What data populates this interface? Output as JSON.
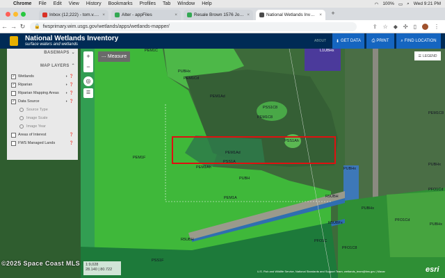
{
  "menubar": {
    "items": [
      "Chrome",
      "File",
      "Edit",
      "View",
      "History",
      "Bookmarks",
      "Profiles",
      "Tab",
      "Window",
      "Help"
    ],
    "battery": "100%",
    "clock": "Wed 9:21 PM"
  },
  "tabs": [
    {
      "title": "Inbox (12,222) - tom.v.donnel...",
      "color": "#d93025"
    },
    {
      "title": "Alter - appFiles",
      "color": "#34a853"
    },
    {
      "title": "Resale Brown 1576 Jones Rd ...",
      "color": "#34a853"
    },
    {
      "title": "National Wetlands Inventory",
      "color": "#4a4a4a",
      "active": true
    }
  ],
  "address": {
    "url": "fwsprimary.wim.usgs.gov/wetlands/apps/wetlands-mapper/"
  },
  "app": {
    "title": "National Wetlands Inventory",
    "subtitle": "surface waters and wetlands",
    "about": "ABOUT",
    "buttons": {
      "get_data": "GET DATA",
      "print": "PRINT",
      "find_location": "FIND LOCATION"
    }
  },
  "panel": {
    "basemaps": "BASEMAPS",
    "map_layers": "MAP LAYERS",
    "layers": [
      {
        "label": "Wetlands",
        "checked": true
      },
      {
        "label": "Riparian",
        "checked": true
      },
      {
        "label": "Riparian Mapping Areas",
        "checked": false
      },
      {
        "label": "Data Source",
        "checked": true
      }
    ],
    "sub_options": [
      "Source Type",
      "Image Scale",
      "Image Year"
    ],
    "extra_layers": [
      {
        "label": "Areas of Interest",
        "checked": false
      },
      {
        "label": "FWS Managed Lands",
        "checked": false
      }
    ]
  },
  "map": {
    "measure": "Measure",
    "legend": "LEGEND",
    "scale_line1": "1:9,028",
    "scale_line2": "28.140 | 80.722",
    "attribution": "U.S. Fish and Wildlife Service, National Standards and Support Team, wetlands_team@fws.gov | Maxar",
    "esri": "esri",
    "labels": {
      "pem1c": "PEM1C",
      "l1ubhx": "L1UBHx",
      "pubhx": "PUBHx",
      "pem1cd_a": "PEM1Cd",
      "pem1ad": "PEM1Ad",
      "pss1c8": "PSS1C8",
      "pem1c8": "PEM1C8",
      "pss1ah": "PSS1Ah",
      "pem1ad2": "PEM1Ad",
      "pss1a": "PSS1A",
      "pem1f": "PEM1F",
      "pem1ah": "PEM1Ah",
      "pubh": "PUBH",
      "pubhx2": "PUBHx",
      "pem1a": "PEM1A",
      "r5ubh": "R5UBH",
      "pubhx3": "PUBHx",
      "pfo1cd": "PFO1Cd",
      "pfo1c8": "PFO1C8",
      "r5ubfx": "R5UBFx",
      "pss1f": "PSS1F",
      "pfo1c": "PFO1C",
      "pubhx4": "PUBHx",
      "pem1c8b": "PEM1C8",
      "pubhx5": "PUBHx",
      "r5ubh2": "R5UBH",
      "pfo1cd2": "PFO1Cd"
    }
  },
  "watermark": "©2025 Space Coast MLS"
}
